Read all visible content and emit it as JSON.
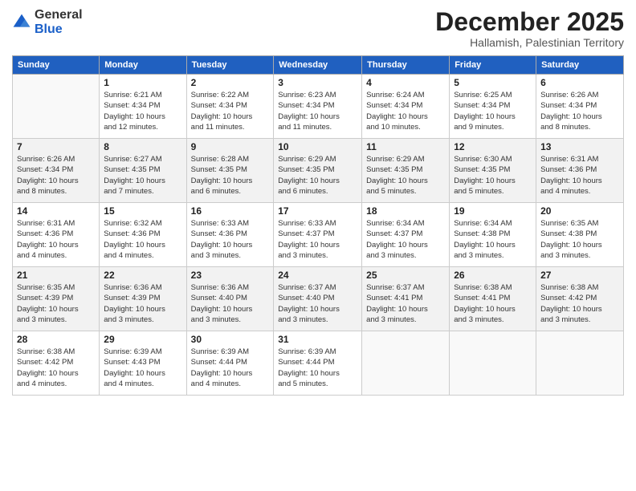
{
  "logo": {
    "general": "General",
    "blue": "Blue"
  },
  "header": {
    "month": "December 2025",
    "location": "Hallamish, Palestinian Territory"
  },
  "weekdays": [
    "Sunday",
    "Monday",
    "Tuesday",
    "Wednesday",
    "Thursday",
    "Friday",
    "Saturday"
  ],
  "weeks": [
    [
      {
        "day": "",
        "info": ""
      },
      {
        "day": "1",
        "info": "Sunrise: 6:21 AM\nSunset: 4:34 PM\nDaylight: 10 hours\nand 12 minutes."
      },
      {
        "day": "2",
        "info": "Sunrise: 6:22 AM\nSunset: 4:34 PM\nDaylight: 10 hours\nand 11 minutes."
      },
      {
        "day": "3",
        "info": "Sunrise: 6:23 AM\nSunset: 4:34 PM\nDaylight: 10 hours\nand 11 minutes."
      },
      {
        "day": "4",
        "info": "Sunrise: 6:24 AM\nSunset: 4:34 PM\nDaylight: 10 hours\nand 10 minutes."
      },
      {
        "day": "5",
        "info": "Sunrise: 6:25 AM\nSunset: 4:34 PM\nDaylight: 10 hours\nand 9 minutes."
      },
      {
        "day": "6",
        "info": "Sunrise: 6:26 AM\nSunset: 4:34 PM\nDaylight: 10 hours\nand 8 minutes."
      }
    ],
    [
      {
        "day": "7",
        "info": "Sunrise: 6:26 AM\nSunset: 4:34 PM\nDaylight: 10 hours\nand 8 minutes."
      },
      {
        "day": "8",
        "info": "Sunrise: 6:27 AM\nSunset: 4:35 PM\nDaylight: 10 hours\nand 7 minutes."
      },
      {
        "day": "9",
        "info": "Sunrise: 6:28 AM\nSunset: 4:35 PM\nDaylight: 10 hours\nand 6 minutes."
      },
      {
        "day": "10",
        "info": "Sunrise: 6:29 AM\nSunset: 4:35 PM\nDaylight: 10 hours\nand 6 minutes."
      },
      {
        "day": "11",
        "info": "Sunrise: 6:29 AM\nSunset: 4:35 PM\nDaylight: 10 hours\nand 5 minutes."
      },
      {
        "day": "12",
        "info": "Sunrise: 6:30 AM\nSunset: 4:35 PM\nDaylight: 10 hours\nand 5 minutes."
      },
      {
        "day": "13",
        "info": "Sunrise: 6:31 AM\nSunset: 4:36 PM\nDaylight: 10 hours\nand 4 minutes."
      }
    ],
    [
      {
        "day": "14",
        "info": "Sunrise: 6:31 AM\nSunset: 4:36 PM\nDaylight: 10 hours\nand 4 minutes."
      },
      {
        "day": "15",
        "info": "Sunrise: 6:32 AM\nSunset: 4:36 PM\nDaylight: 10 hours\nand 4 minutes."
      },
      {
        "day": "16",
        "info": "Sunrise: 6:33 AM\nSunset: 4:36 PM\nDaylight: 10 hours\nand 3 minutes."
      },
      {
        "day": "17",
        "info": "Sunrise: 6:33 AM\nSunset: 4:37 PM\nDaylight: 10 hours\nand 3 minutes."
      },
      {
        "day": "18",
        "info": "Sunrise: 6:34 AM\nSunset: 4:37 PM\nDaylight: 10 hours\nand 3 minutes."
      },
      {
        "day": "19",
        "info": "Sunrise: 6:34 AM\nSunset: 4:38 PM\nDaylight: 10 hours\nand 3 minutes."
      },
      {
        "day": "20",
        "info": "Sunrise: 6:35 AM\nSunset: 4:38 PM\nDaylight: 10 hours\nand 3 minutes."
      }
    ],
    [
      {
        "day": "21",
        "info": "Sunrise: 6:35 AM\nSunset: 4:39 PM\nDaylight: 10 hours\nand 3 minutes."
      },
      {
        "day": "22",
        "info": "Sunrise: 6:36 AM\nSunset: 4:39 PM\nDaylight: 10 hours\nand 3 minutes."
      },
      {
        "day": "23",
        "info": "Sunrise: 6:36 AM\nSunset: 4:40 PM\nDaylight: 10 hours\nand 3 minutes."
      },
      {
        "day": "24",
        "info": "Sunrise: 6:37 AM\nSunset: 4:40 PM\nDaylight: 10 hours\nand 3 minutes."
      },
      {
        "day": "25",
        "info": "Sunrise: 6:37 AM\nSunset: 4:41 PM\nDaylight: 10 hours\nand 3 minutes."
      },
      {
        "day": "26",
        "info": "Sunrise: 6:38 AM\nSunset: 4:41 PM\nDaylight: 10 hours\nand 3 minutes."
      },
      {
        "day": "27",
        "info": "Sunrise: 6:38 AM\nSunset: 4:42 PM\nDaylight: 10 hours\nand 3 minutes."
      }
    ],
    [
      {
        "day": "28",
        "info": "Sunrise: 6:38 AM\nSunset: 4:42 PM\nDaylight: 10 hours\nand 4 minutes."
      },
      {
        "day": "29",
        "info": "Sunrise: 6:39 AM\nSunset: 4:43 PM\nDaylight: 10 hours\nand 4 minutes."
      },
      {
        "day": "30",
        "info": "Sunrise: 6:39 AM\nSunset: 4:44 PM\nDaylight: 10 hours\nand 4 minutes."
      },
      {
        "day": "31",
        "info": "Sunrise: 6:39 AM\nSunset: 4:44 PM\nDaylight: 10 hours\nand 5 minutes."
      },
      {
        "day": "",
        "info": ""
      },
      {
        "day": "",
        "info": ""
      },
      {
        "day": "",
        "info": ""
      }
    ]
  ]
}
